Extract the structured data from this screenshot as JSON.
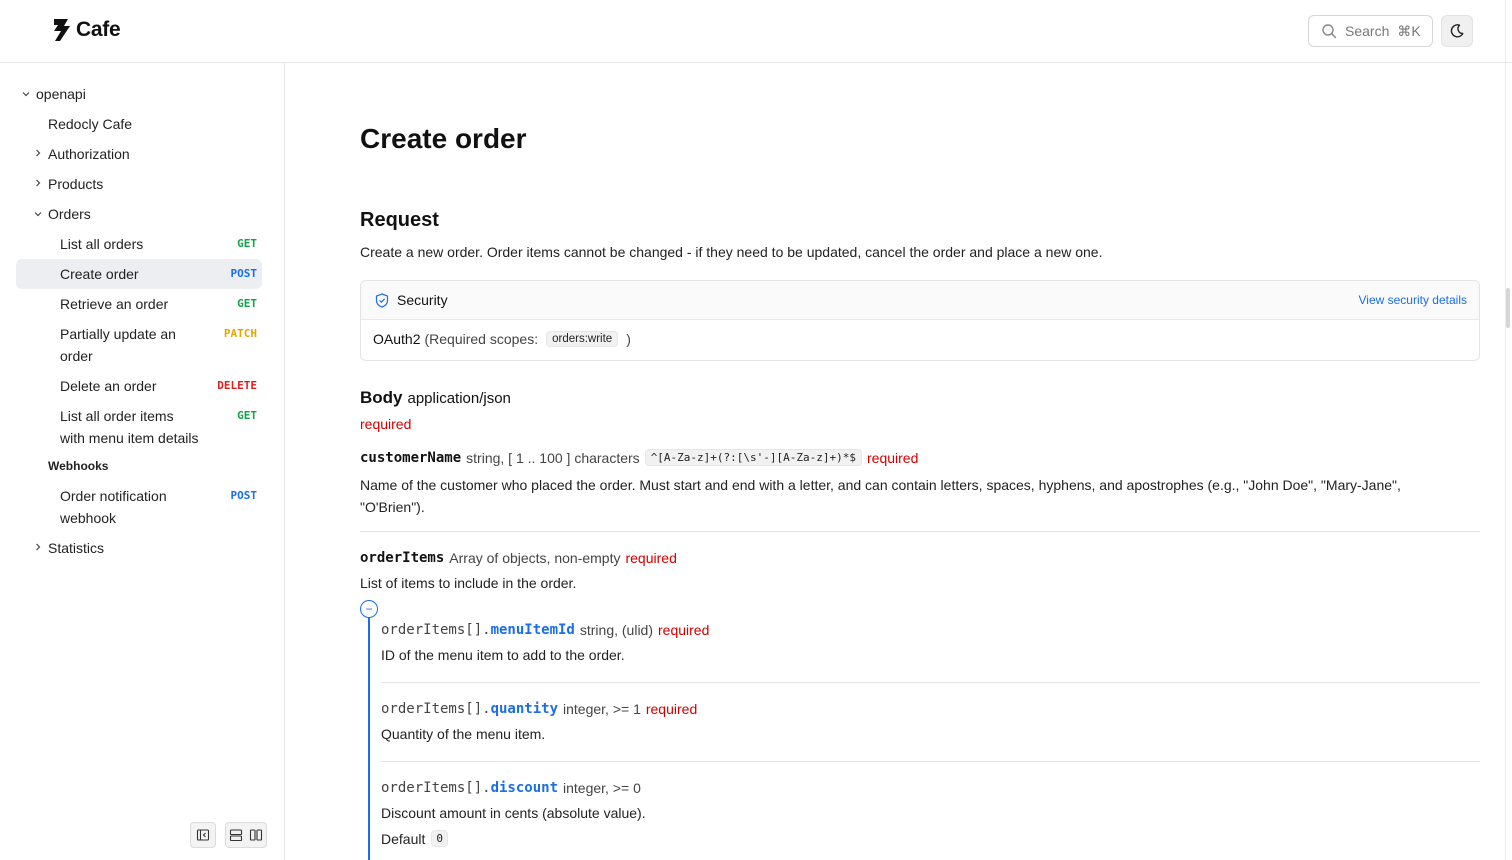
{
  "app": {
    "name": "Cafe"
  },
  "header": {
    "search_placeholder": "Search",
    "search_shortcut": "⌘K"
  },
  "sidebar": {
    "root": "openapi",
    "items": [
      {
        "label": "Redocly Cafe"
      },
      {
        "label": "Authorization"
      },
      {
        "label": "Products"
      },
      {
        "label": "Orders"
      },
      {
        "label": "List all orders",
        "method": "GET"
      },
      {
        "label": "Create order",
        "method": "POST"
      },
      {
        "label": "Retrieve an order",
        "method": "GET"
      },
      {
        "label_line1": "Partially update an",
        "label_line2": "order",
        "method": "PATCH"
      },
      {
        "label": "Delete an order",
        "method": "DELETE"
      },
      {
        "label_line1": "List all order items",
        "label_line2": "with menu item details",
        "method": "GET"
      },
      {
        "label_line1": "Order notification",
        "label_line2": "webhook",
        "method": "POST"
      },
      {
        "label": "Statistics"
      }
    ],
    "group_webhooks": "Webhooks"
  },
  "colors": {
    "get": "#12a34a",
    "post": "#1a6ee6",
    "patch": "#e0a800",
    "delete": "#d92020",
    "required": "#d10000",
    "link": "#1a6ee6"
  },
  "main": {
    "title": "Create order",
    "request_heading": "Request",
    "request_description": "Create a new order. Order items cannot be changed - if they need to be updated, cancel the order and place a new one.",
    "security": {
      "label": "Security",
      "link": "View security details",
      "scheme": "OAuth2",
      "scopes_prefix": "(Required scopes:",
      "scope": "orders:write",
      "scopes_suffix": ")"
    },
    "body": {
      "heading": "Body",
      "content_type": "application/json",
      "required": "required"
    },
    "fields": {
      "customerName": {
        "name": "customerName",
        "type": "string, [ 1 .. 100 ] characters",
        "pattern": "^[A-Za-z]+(?:[\\s'-][A-Za-z]+)*$",
        "required": "required",
        "desc_line1": "Name of the customer who placed the order. Must start and end with a letter, and can contain letters, spaces, hyphens, and apostrophes (e.g., \"John Doe\", \"Mary-Jane\",",
        "desc_line2": "\"O'Brien\")."
      },
      "orderItems": {
        "name": "orderItems",
        "type": "Array of objects, non-empty",
        "required": "required",
        "desc": "List of items to include in the order.",
        "collapse": "−"
      },
      "menuItemId": {
        "prefix": "orderItems[].",
        "name": "menuItemId",
        "type": "string, (ulid)",
        "required": "required",
        "desc": "ID of the menu item to add to the order."
      },
      "quantity": {
        "prefix": "orderItems[].",
        "name": "quantity",
        "type": "integer, >= 1",
        "required": "required",
        "desc": "Quantity of the menu item."
      },
      "discount": {
        "prefix": "orderItems[].",
        "name": "discount",
        "type": "integer, >= 0",
        "desc": "Discount amount in cents (absolute value).",
        "default_label": "Default",
        "default_value": "0"
      }
    }
  }
}
